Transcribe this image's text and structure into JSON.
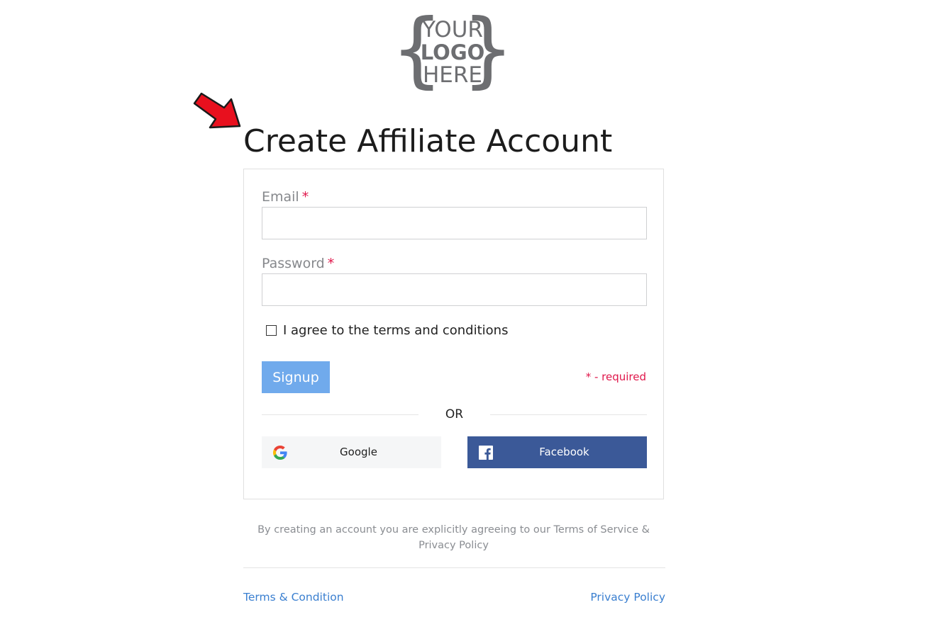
{
  "logo": {
    "line1": "YOUR",
    "line2": "LOGO",
    "line3": "HERE",
    "left_brace": "{",
    "right_brace": "}",
    "color": "#6d6e71"
  },
  "annotation": {
    "icon": "red-arrow-icon",
    "color": "#e8101e"
  },
  "page": {
    "title": "Create Affiliate Account"
  },
  "form": {
    "email": {
      "label": "Email",
      "required_mark": "*",
      "value": "",
      "placeholder": ""
    },
    "password": {
      "label": "Password",
      "required_mark": "*",
      "value": "",
      "placeholder": ""
    },
    "terms_checkbox": {
      "label": "I agree to the terms and conditions",
      "checked": false
    },
    "signup_label": "Signup",
    "required_note": "* - required",
    "or_text": "OR",
    "google_label": "Google",
    "facebook_label": "Facebook"
  },
  "footer": {
    "consent_text": "By creating an account you are explicitly agreeing to our Terms of Service & Privacy Policy",
    "terms_link": "Terms & Condition",
    "privacy_link": "Privacy Policy"
  },
  "colors": {
    "accent": "#70aaec",
    "required": "#e0174b",
    "facebook": "#3b5998",
    "link": "#3a7fd0"
  }
}
